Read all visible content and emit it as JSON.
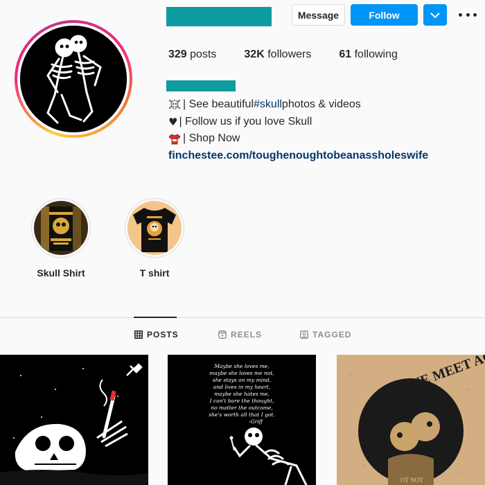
{
  "profile": {
    "stats": {
      "posts_count": "329",
      "posts_label": "posts",
      "followers_count": "32K",
      "followers_label": "followers",
      "following_count": "61",
      "following_label": "following"
    },
    "bio": {
      "line1_prefix": "| See beautiful ",
      "line1_hashtag": "#skull",
      "line1_suffix": " photos & videos",
      "line2": "| Follow us if you love Skull",
      "line3": "| Shop Now",
      "link": "finchestee.com/toughenoughtobeanassholeswife"
    }
  },
  "actions": {
    "message_label": "Message",
    "follow_label": "Follow"
  },
  "highlights": [
    {
      "label": "Skull Shirt"
    },
    {
      "label": "T shirt"
    }
  ],
  "tabs": [
    {
      "label": "POSTS",
      "icon": "grid-icon",
      "active": true
    },
    {
      "label": "REELS",
      "icon": "reels-icon",
      "active": false
    },
    {
      "label": "TAGGED",
      "icon": "tagged-icon",
      "active": false
    }
  ],
  "posts": [
    {
      "pinned": true
    },
    {
      "quote_lines": [
        "Maybe she loves me,",
        "maybe she loves me not,",
        "she stays on my mind,",
        "and lives in my heart,",
        "maybe she hates me,",
        "I can't bare the thought,",
        "no matter the outcome,",
        "she's worth all that I got.",
        "-Griff"
      ]
    },
    {
      "title": "MAY WE MEET AGAIN",
      "subtitle": "OT NOT"
    }
  ],
  "colors": {
    "accent": "#0095f6",
    "redacted": "#0e9ca0",
    "link": "#00376b"
  }
}
